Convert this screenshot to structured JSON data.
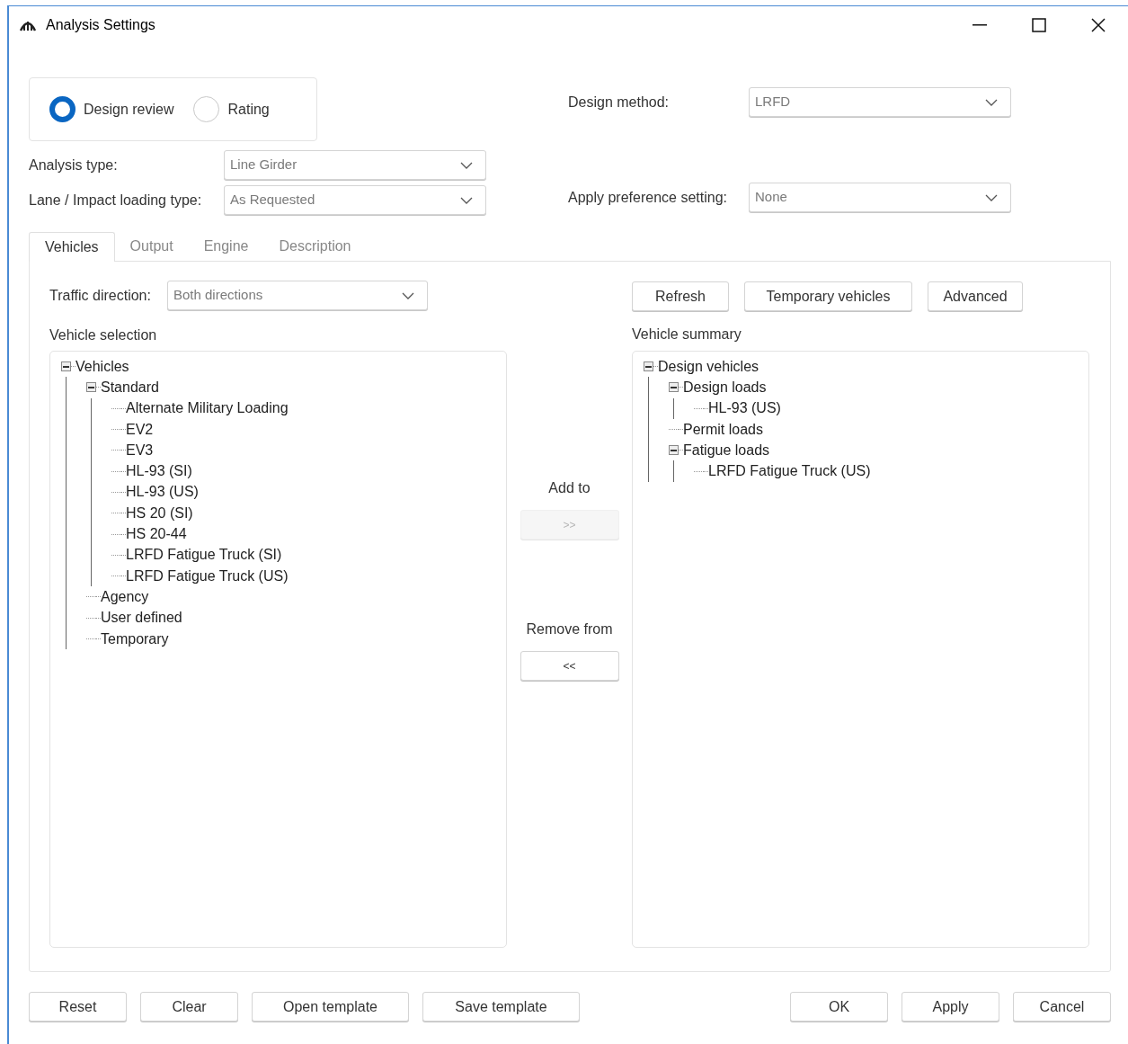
{
  "window": {
    "title": "Analysis Settings"
  },
  "mode_options": [
    {
      "label": "Design review",
      "selected": true
    },
    {
      "label": "Rating",
      "selected": false
    }
  ],
  "design_method": {
    "label": "Design method:",
    "value": "LRFD"
  },
  "analysis_type": {
    "label": "Analysis type:",
    "value": "Line Girder"
  },
  "lane_impact": {
    "label": "Lane / Impact loading type:",
    "value": "As Requested"
  },
  "preference": {
    "label": "Apply preference setting:",
    "value": "None"
  },
  "tabs": [
    {
      "label": "Vehicles",
      "selected": true
    },
    {
      "label": "Output",
      "selected": false
    },
    {
      "label": "Engine",
      "selected": false
    },
    {
      "label": "Description",
      "selected": false
    }
  ],
  "traffic_direction": {
    "label": "Traffic direction:",
    "value": "Both directions"
  },
  "panel_buttons": [
    {
      "label": "Refresh"
    },
    {
      "label": "Temporary vehicles"
    },
    {
      "label": "Advanced"
    }
  ],
  "vehicle_selection": {
    "title": "Vehicle selection",
    "tree": [
      {
        "label": "Vehicles",
        "expanded": true,
        "children": [
          {
            "label": "Standard",
            "expanded": true,
            "children": [
              {
                "label": "Alternate Military Loading"
              },
              {
                "label": "EV2"
              },
              {
                "label": "EV3"
              },
              {
                "label": "HL-93 (SI)"
              },
              {
                "label": "HL-93 (US)"
              },
              {
                "label": "HS 20 (SI)"
              },
              {
                "label": "HS 20-44"
              },
              {
                "label": "LRFD Fatigue Truck (SI)"
              },
              {
                "label": "LRFD Fatigue Truck (US)"
              }
            ]
          },
          {
            "label": "Agency"
          },
          {
            "label": "User defined"
          },
          {
            "label": "Temporary"
          }
        ]
      }
    ]
  },
  "transfer": [
    {
      "caption": "Add to",
      "button": ">>",
      "disabled": true
    },
    {
      "caption": "Remove from",
      "button": "<<",
      "disabled": false
    }
  ],
  "vehicle_summary": {
    "title": "Vehicle summary",
    "tree": [
      {
        "label": "Design vehicles",
        "expanded": true,
        "children": [
          {
            "label": "Design loads",
            "expanded": true,
            "children": [
              {
                "label": "HL-93 (US)"
              }
            ]
          },
          {
            "label": "Permit loads"
          },
          {
            "label": "Fatigue loads",
            "expanded": true,
            "children": [
              {
                "label": "LRFD Fatigue Truck (US)"
              }
            ]
          }
        ]
      }
    ]
  },
  "footer_left": [
    {
      "label": "Reset"
    },
    {
      "label": "Clear"
    },
    {
      "label": "Open template"
    },
    {
      "label": "Save template"
    }
  ],
  "footer_right": [
    {
      "label": "OK"
    },
    {
      "label": "Apply"
    },
    {
      "label": "Cancel"
    }
  ]
}
